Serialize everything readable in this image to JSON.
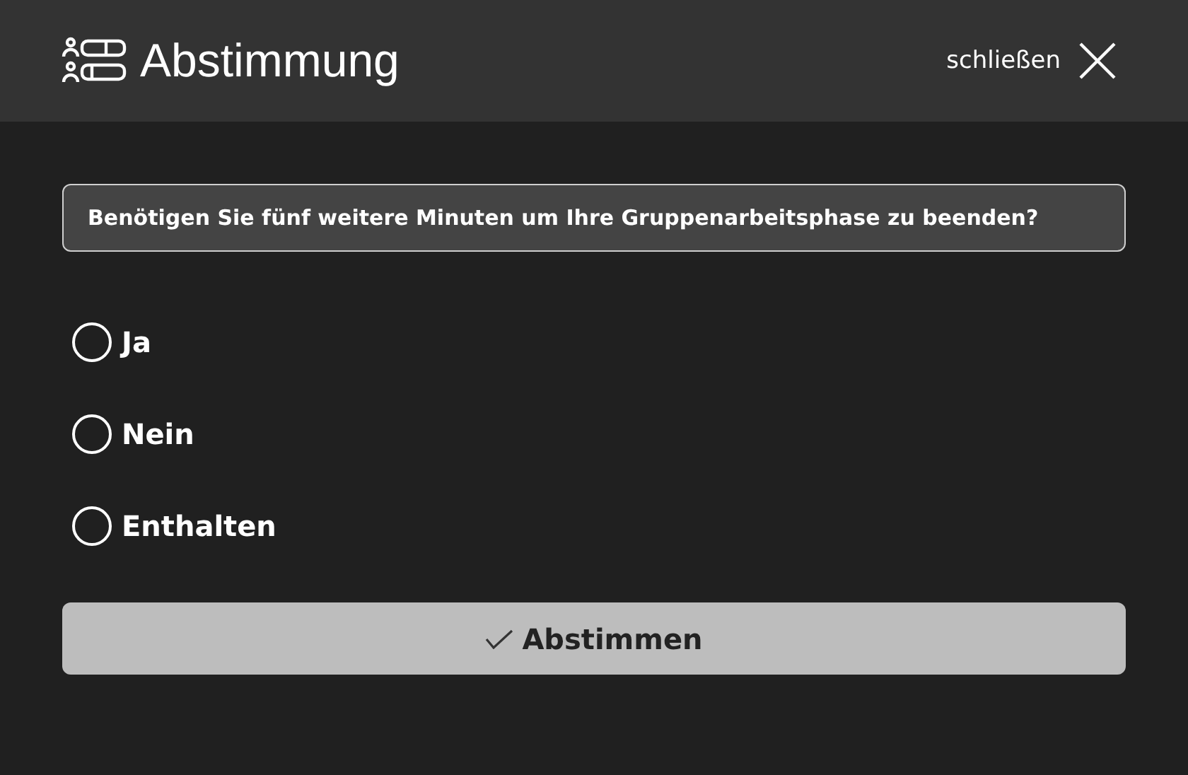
{
  "header": {
    "title": "Abstimmung",
    "close_label": "schließen"
  },
  "question": "Benötigen Sie fünf weitere Minuten um Ihre Gruppenarbeitsphase zu beenden?",
  "options": [
    {
      "label": "Ja",
      "selected": false
    },
    {
      "label": "Nein",
      "selected": false
    },
    {
      "label": "Enthalten",
      "selected": false
    }
  ],
  "submit": {
    "label": "Abstimmen",
    "disabled": true
  }
}
